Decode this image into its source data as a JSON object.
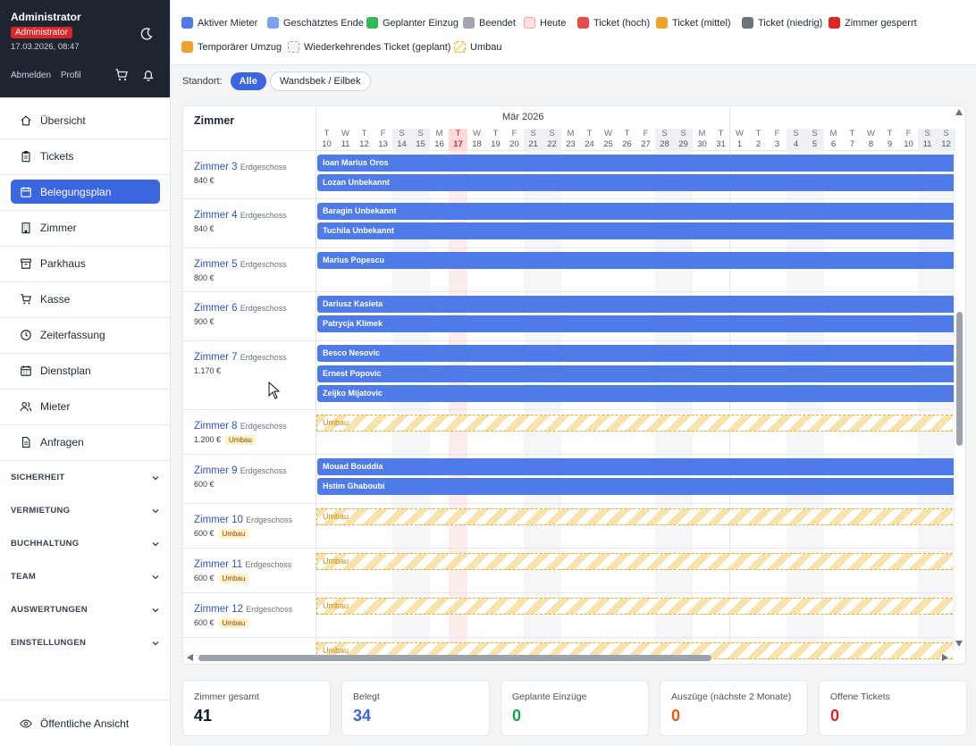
{
  "user": {
    "name": "Administrator",
    "role": "Administrator",
    "datetime": "17.03.2026, 08:47",
    "logout": "Abmelden",
    "profile": "Profil"
  },
  "nav": [
    {
      "label": "Übersicht",
      "icon": "home-icon"
    },
    {
      "label": "Tickets",
      "icon": "clipboard-icon"
    },
    {
      "label": "Belegungsplan",
      "icon": "calendar-icon",
      "active": true
    },
    {
      "label": "Zimmer",
      "icon": "building-icon"
    },
    {
      "label": "Parkhaus",
      "icon": "archive-icon"
    },
    {
      "label": "Kasse",
      "icon": "cart-icon"
    },
    {
      "label": "Zeiterfassung",
      "icon": "clock-icon"
    },
    {
      "label": "Dienstplan",
      "icon": "calendar-grid-icon"
    },
    {
      "label": "Mieter",
      "icon": "users-icon"
    },
    {
      "label": "Anfragen",
      "icon": "document-icon"
    }
  ],
  "sections": [
    "SICHERHEIT",
    "VERMIETUNG",
    "BUCHHALTUNG",
    "TEAM",
    "AUSWERTUNGEN",
    "EINSTELLUNGEN"
  ],
  "public_view": "Öffentliche Ansicht",
  "legend": [
    {
      "label": "Aktiver Mieter",
      "color": "#4f7be8"
    },
    {
      "label": "Geschätztes Ende",
      "color": "#7fa0f0"
    },
    {
      "label": "Geplanter Einzug",
      "color": "#34b85a"
    },
    {
      "label": "Beendet",
      "color": "#a1a6b0"
    },
    {
      "label": "Heute",
      "color": "#fde2e2"
    },
    {
      "label": "Ticket (hoch)",
      "color": "#e44b4b"
    },
    {
      "label": "Ticket (mittel)",
      "color": "#eea22c"
    },
    {
      "label": "Ticket (niedrig)",
      "color": "#6b7280"
    },
    {
      "label": "Zimmer gesperrt",
      "color": "#d92626"
    },
    {
      "label": "Temporärer Umzug",
      "color": "#eea22c"
    },
    {
      "label": "Wiederkehrendes Ticket (geplant)",
      "color": "#e5e7eb"
    },
    {
      "label": "Umbau",
      "color": "#f8e3ad"
    }
  ],
  "standort": {
    "label": "Standort:",
    "options": [
      "Alle",
      "Wandsbek / Eilbek"
    ],
    "selected": "Alle"
  },
  "calendar": {
    "header": "Zimmer",
    "month": "Mär 2026",
    "days": [
      {
        "w": "T",
        "d": "10"
      },
      {
        "w": "W",
        "d": "11"
      },
      {
        "w": "T",
        "d": "12"
      },
      {
        "w": "F",
        "d": "13"
      },
      {
        "w": "S",
        "d": "14"
      },
      {
        "w": "S",
        "d": "15"
      },
      {
        "w": "M",
        "d": "16"
      },
      {
        "w": "T",
        "d": "17"
      },
      {
        "w": "W",
        "d": "18"
      },
      {
        "w": "T",
        "d": "19"
      },
      {
        "w": "F",
        "d": "20"
      },
      {
        "w": "S",
        "d": "21"
      },
      {
        "w": "S",
        "d": "22"
      },
      {
        "w": "M",
        "d": "23"
      },
      {
        "w": "T",
        "d": "24"
      },
      {
        "w": "W",
        "d": "25"
      },
      {
        "w": "T",
        "d": "26"
      },
      {
        "w": "F",
        "d": "27"
      },
      {
        "w": "S",
        "d": "28"
      },
      {
        "w": "S",
        "d": "29"
      },
      {
        "w": "M",
        "d": "30"
      },
      {
        "w": "T",
        "d": "31"
      },
      {
        "w": "W",
        "d": "1"
      },
      {
        "w": "T",
        "d": "2"
      },
      {
        "w": "F",
        "d": "3"
      },
      {
        "w": "S",
        "d": "4"
      },
      {
        "w": "S",
        "d": "5"
      },
      {
        "w": "M",
        "d": "6"
      },
      {
        "w": "T",
        "d": "7"
      },
      {
        "w": "W",
        "d": "8"
      },
      {
        "w": "T",
        "d": "9"
      },
      {
        "w": "F",
        "d": "10"
      },
      {
        "w": "S",
        "d": "11"
      },
      {
        "w": "S",
        "d": "12"
      }
    ],
    "today_index": 7,
    "rooms": [
      {
        "name": "Zimmer 3",
        "floor": "Erdgeschoss",
        "price": "840 €",
        "badge": "",
        "tenants": [
          "Ioan Marius Oros",
          "Lozan Unbekannt"
        ]
      },
      {
        "name": "Zimmer 4",
        "floor": "Erdgeschoss",
        "price": "840 €",
        "badge": "",
        "tenants": [
          "Baragin Unbekannt",
          "Tuchila Unbekannt"
        ]
      },
      {
        "name": "Zimmer 5",
        "floor": "Erdgeschoss",
        "price": "800 €",
        "badge": "",
        "tenants": [
          "Marius Popescu"
        ]
      },
      {
        "name": "Zimmer 6",
        "floor": "Erdgeschoss",
        "price": "900 €",
        "badge": "",
        "tenants": [
          "Dariusz Kasieta",
          "Patrycja Klimek"
        ]
      },
      {
        "name": "Zimmer 7",
        "floor": "Erdgeschoss",
        "price": "1.170 €",
        "badge": "",
        "tenants": [
          "Besco Nesovic",
          "Ernest Popovic",
          "Zeljko Mijatovic"
        ]
      },
      {
        "name": "Zimmer 8",
        "floor": "Erdgeschoss",
        "price": "1.200 €",
        "badge": "Umbau",
        "tenants": [],
        "umbau": "Umbau"
      },
      {
        "name": "Zimmer 9",
        "floor": "Erdgeschoss",
        "price": "600 €",
        "badge": "",
        "tenants": [
          "Mouad Bouddia",
          "Hstim Ghaboubi"
        ]
      },
      {
        "name": "Zimmer 10",
        "floor": "Erdgeschoss",
        "price": "600 €",
        "badge": "Umbau",
        "tenants": [],
        "umbau": "Umbau"
      },
      {
        "name": "Zimmer 11",
        "floor": "Erdgeschoss",
        "price": "600 €",
        "badge": "Umbau",
        "tenants": [],
        "umbau": "Umbau"
      },
      {
        "name": "Zimmer 12",
        "floor": "Erdgeschoss",
        "price": "600 €",
        "badge": "Umbau",
        "tenants": [],
        "umbau": "Umbau"
      },
      {
        "name": "",
        "floor": "",
        "price": "",
        "badge": "",
        "tenants": [],
        "umbau": "Umbau"
      }
    ]
  },
  "stats": [
    {
      "label": "Zimmer gesamt",
      "value": "41",
      "color": "#111827"
    },
    {
      "label": "Belegt",
      "value": "34",
      "color": "#3b66e0"
    },
    {
      "label": "Geplante Einzüge",
      "value": "0",
      "color": "#16a34a"
    },
    {
      "label": "Auszüge (nächste 2 Monate)",
      "value": "0",
      "color": "#ea580c"
    },
    {
      "label": "Offene Tickets",
      "value": "0",
      "color": "#dc2626"
    }
  ]
}
